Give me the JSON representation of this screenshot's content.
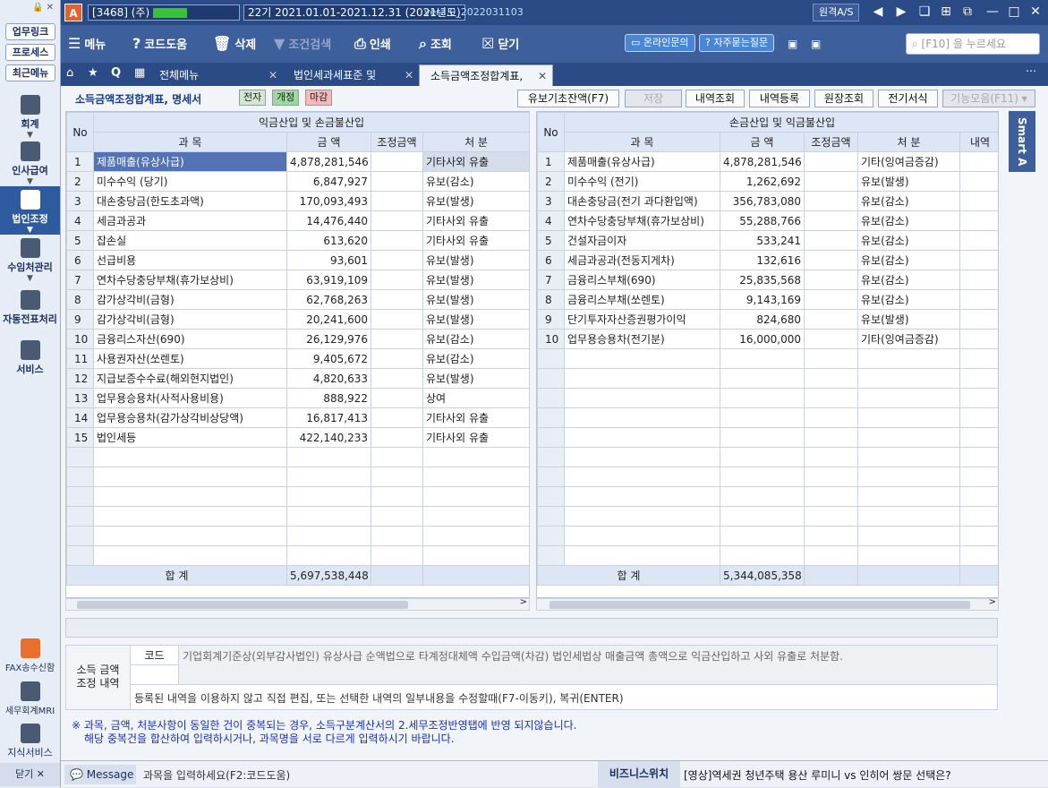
{
  "app": {
    "company": "[3468] (주)",
    "period": "22기  2021.01.01-2021.12.31 (2021년도)",
    "version": "ver2.0_2022031103",
    "remote": "원격A/S"
  },
  "left_top": {
    "buttons": [
      "업무링크",
      "프로세스",
      "최근메뉴"
    ]
  },
  "toolbar": {
    "menu": "메뉴",
    "code_help": "코드도움",
    "delete": "삭제",
    "cond_search": "조건검색",
    "print": "인쇄",
    "inquiry": "조회",
    "close": "닫기",
    "online_inquiry": "온라인문의",
    "faq": "자주묻는질문",
    "search_placeholder": "[F10] 을 누르세요"
  },
  "tabs": [
    {
      "label": "전체메뉴"
    },
    {
      "label": "법인세과세표준 및"
    },
    {
      "label": "소득금액조정합계표,"
    }
  ],
  "nav": [
    {
      "label": "회계"
    },
    {
      "label": "인사급여"
    },
    {
      "label": "법인조정"
    },
    {
      "label": "수임처관리"
    },
    {
      "label": "자동전표처리"
    },
    {
      "label": "서비스"
    },
    {
      "label": "FAX송수신함"
    },
    {
      "label": "세무회계MRI"
    },
    {
      "label": "지식서비스"
    },
    {
      "label": "닫기"
    }
  ],
  "smart": "Smart A",
  "page": {
    "title": "소득금액조정합계표, 명세서",
    "tag_e": "전자",
    "tag_rev": "개정",
    "tag_close": "마감",
    "buttons": {
      "basic_balance": "유보기초잔액(F7)",
      "save": "저장",
      "detail_inquiry": "내역조회",
      "detail_register": "내역등록",
      "ledger_inquiry": "원장조회",
      "prev_format": "전기서식",
      "func_collection": "기능모음(F11)"
    }
  },
  "left_grid": {
    "group_title": "익금산입 및 손금불산입",
    "headers": {
      "no": "No",
      "item": "과 목",
      "amount": "금 액",
      "adjust": "조정금액",
      "process": "처 분"
    },
    "rows": [
      {
        "no": "1",
        "item": "제품매출(유상사급)",
        "amount": "4,878,281,546",
        "process": "기타사외 유출"
      },
      {
        "no": "2",
        "item": "미수수익 (당기)",
        "amount": "6,847,927",
        "process": "유보(감소)"
      },
      {
        "no": "3",
        "item": "대손충당금(한도초과액)",
        "amount": "170,093,493",
        "process": "유보(발생)"
      },
      {
        "no": "4",
        "item": "세금과공과",
        "amount": "14,476,440",
        "process": "기타사외 유출"
      },
      {
        "no": "5",
        "item": "잡손실",
        "amount": "613,620",
        "process": "기타사외 유출"
      },
      {
        "no": "6",
        "item": "선급비용",
        "amount": "93,601",
        "process": "유보(발생)"
      },
      {
        "no": "7",
        "item": "연차수당충당부채(휴가보상비)",
        "amount": "63,919,109",
        "process": "유보(발생)"
      },
      {
        "no": "8",
        "item": "감가상각비(금형)",
        "amount": "62,768,263",
        "process": "유보(발생)"
      },
      {
        "no": "9",
        "item": "감가상각비(금형)",
        "amount": "20,241,600",
        "process": "유보(발생)"
      },
      {
        "no": "10",
        "item": "금융리스자산(690)",
        "amount": "26,129,976",
        "process": "유보(감소)"
      },
      {
        "no": "11",
        "item": "사용권자산(쏘렌토)",
        "amount": "9,405,672",
        "process": "유보(감소)"
      },
      {
        "no": "12",
        "item": "지급보증수수료(해외현지법인)",
        "amount": "4,820,633",
        "process": "유보(발생)"
      },
      {
        "no": "13",
        "item": "업무용승용차(사적사용비용)",
        "amount": "888,922",
        "process": "상여"
      },
      {
        "no": "14",
        "item": "업무용승용차(감가상각비상당액)",
        "amount": "16,817,413",
        "process": "기타사외 유출"
      },
      {
        "no": "15",
        "item": "법인세등",
        "amount": "422,140,233",
        "process": "기타사외 유출"
      }
    ],
    "total_label": "합 계",
    "total_amount": "5,697,538,448"
  },
  "right_grid": {
    "group_title": "손금산입 및 익금불산입",
    "headers": {
      "no": "No",
      "item": "과 목",
      "amount": "금 액",
      "adjust": "조정금액",
      "process": "처 분",
      "detail": "내역"
    },
    "rows": [
      {
        "no": "1",
        "item": "제품매출(유상사급)",
        "amount": "4,878,281,546",
        "process": "기타(잉여금증감)"
      },
      {
        "no": "2",
        "item": "미수수익 (전기)",
        "amount": "1,262,692",
        "process": "유보(발생)"
      },
      {
        "no": "3",
        "item": "대손충당금(전기 과다환입액)",
        "amount": "356,783,080",
        "process": "유보(감소)"
      },
      {
        "no": "4",
        "item": "연차수당충당부채(휴가보상비)",
        "amount": "55,288,766",
        "process": "유보(감소)"
      },
      {
        "no": "5",
        "item": "건설자금이자",
        "amount": "533,241",
        "process": "유보(감소)"
      },
      {
        "no": "6",
        "item": "세금과공과(전동지게차)",
        "amount": "132,616",
        "process": "유보(감소)"
      },
      {
        "no": "7",
        "item": "금융리스부채(690)",
        "amount": "25,835,568",
        "process": "유보(감소)"
      },
      {
        "no": "8",
        "item": "금융리스부채(쏘렌토)",
        "amount": "9,143,169",
        "process": "유보(감소)"
      },
      {
        "no": "9",
        "item": "단기투자자산증권평가이익",
        "amount": "824,680",
        "process": "유보(발생)"
      },
      {
        "no": "10",
        "item": "업무용승용차(전기분)",
        "amount": "16,000,000",
        "process": "기타(잉여금증감)"
      }
    ],
    "total_label": "합 계",
    "total_amount": "5,344,085,358"
  },
  "description": {
    "label": "소득 금액\n조정 내역",
    "code_label": "코드",
    "text": "기업회계기준상(외부감사법인) 유상사급 순액법으로 타계정대체액 수입금액(차감) 법인세법상 매출금액 총액으로 익금산입하고 사외 유출로 처분함.",
    "hint": "등록된 내역을 이용하지 않고 직접 편집, 또는 선택한 내역의 일부내용을 수정할때(F7-이동키), 복귀(ENTER)"
  },
  "note": {
    "line1": "※ 과목, 금액, 처분사항이 동일한 건이 중복되는 경우, 소득구분계산서의 2.세무조정반영탭에 반영 되지않습니다.",
    "line2": "해당 중복건을 합산하여 입력하시거나, 과목명을 서로 다르게 입력하시기 바랍니다."
  },
  "status": {
    "message_label": "Message",
    "message": "과목을 입력하세요(F2:코드도움)",
    "news_label": "비즈니스위치",
    "news": "[영상]역세권 청년주택 용산 루미니 vs 인히어 쌍문 선택은?"
  }
}
